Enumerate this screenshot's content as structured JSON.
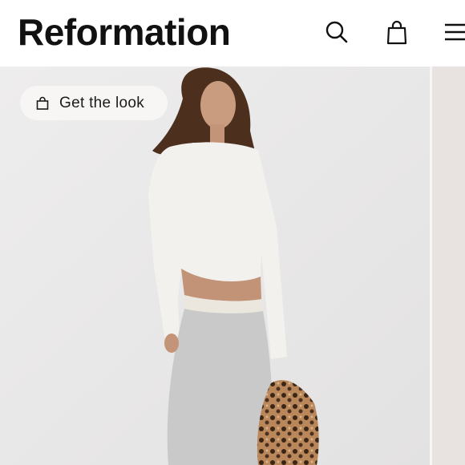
{
  "header": {
    "brand": "Reformation",
    "icons": [
      "search-icon",
      "shopping-bag-icon",
      "menu-icon"
    ]
  },
  "hero": {
    "get_the_look_label": "Get the look",
    "get_the_look_icon": "shopping-bag-icon",
    "image": "model wearing white cropped long-sleeve tee and grey sweatpants holding leopard print jacket"
  },
  "colors": {
    "brand_text": "#111111",
    "background": "#ffffff",
    "photo_wall": "#e9e8e8",
    "pill_bg": "#f7f6f5"
  }
}
